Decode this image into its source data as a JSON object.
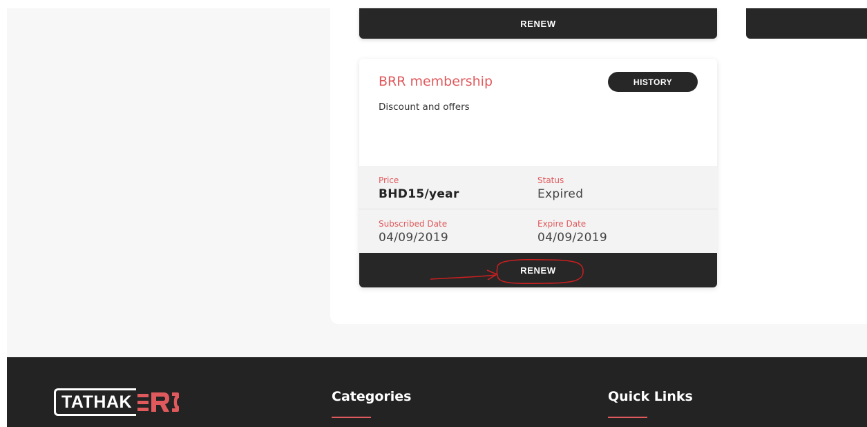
{
  "top_card": {
    "renew_label": "RENEW"
  },
  "membership_card": {
    "title": "BRR membership",
    "history_label": "HISTORY",
    "description": "Discount and offers",
    "price_label": "Price",
    "price_value": "BHD15/year",
    "status_label": "Status",
    "status_value": "Expired",
    "subscribed_label": "Subscribed Date",
    "subscribed_value": "04/09/2019",
    "expire_label": "Expire Date",
    "expire_value": "04/09/2019",
    "renew_label": "RENEW"
  },
  "footer": {
    "logo": "TATHAKER",
    "categories_heading": "Categories",
    "quick_links_heading": "Quick Links"
  },
  "colors": {
    "accent": "#e0595c",
    "dark": "#272727",
    "page_bg": "#f7f7f7",
    "annotation": "#cc1f1f"
  }
}
